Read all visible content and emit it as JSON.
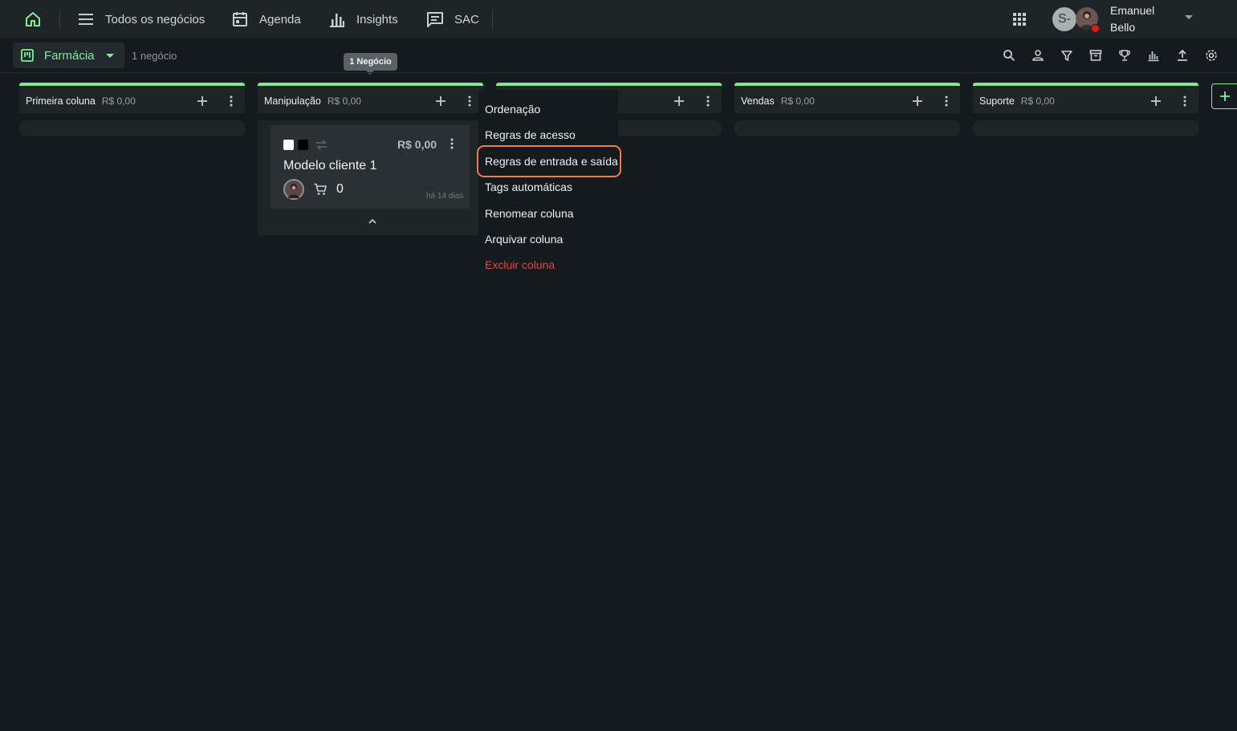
{
  "nav": {
    "items": [
      {
        "label": "Todos os negócios",
        "icon": "menu-icon"
      },
      {
        "label": "Agenda",
        "icon": "calendar-icon"
      },
      {
        "label": "Insights",
        "icon": "bar-chart-icon"
      },
      {
        "label": "SAC",
        "icon": "chat-icon"
      }
    ],
    "user": {
      "initial": "S-",
      "first_name": "Emanuel",
      "last_name": "Bello",
      "status_color": "#e01919"
    }
  },
  "toolbar": {
    "pipeline_name": "Farmácia",
    "deal_count": "1 negócio",
    "tooltip": "1 Negócio",
    "accent": "#7ef09a"
  },
  "columns": [
    {
      "title": "Primeira coluna",
      "value": "R$ 0,00"
    },
    {
      "title": "Manipulação",
      "value": "R$ 0,00"
    },
    {
      "title": "",
      "value": ""
    },
    {
      "title": "Vendas",
      "value": "R$ 0,00"
    },
    {
      "title": "Suporte",
      "value": "R$ 0,00"
    }
  ],
  "card": {
    "value": "R$ 0,00",
    "title": "Modelo cliente 1",
    "cart_count": "0",
    "time": "há 14 dias"
  },
  "menu": {
    "items": [
      "Ordenação",
      "Regras de acesso",
      "Regras de entrada e saída",
      "Tags automáticas",
      "Renomear coluna",
      "Arquivar coluna",
      "Excluir coluna"
    ],
    "highlight_color": "#f07a4a",
    "danger_color": "#e8453c"
  }
}
